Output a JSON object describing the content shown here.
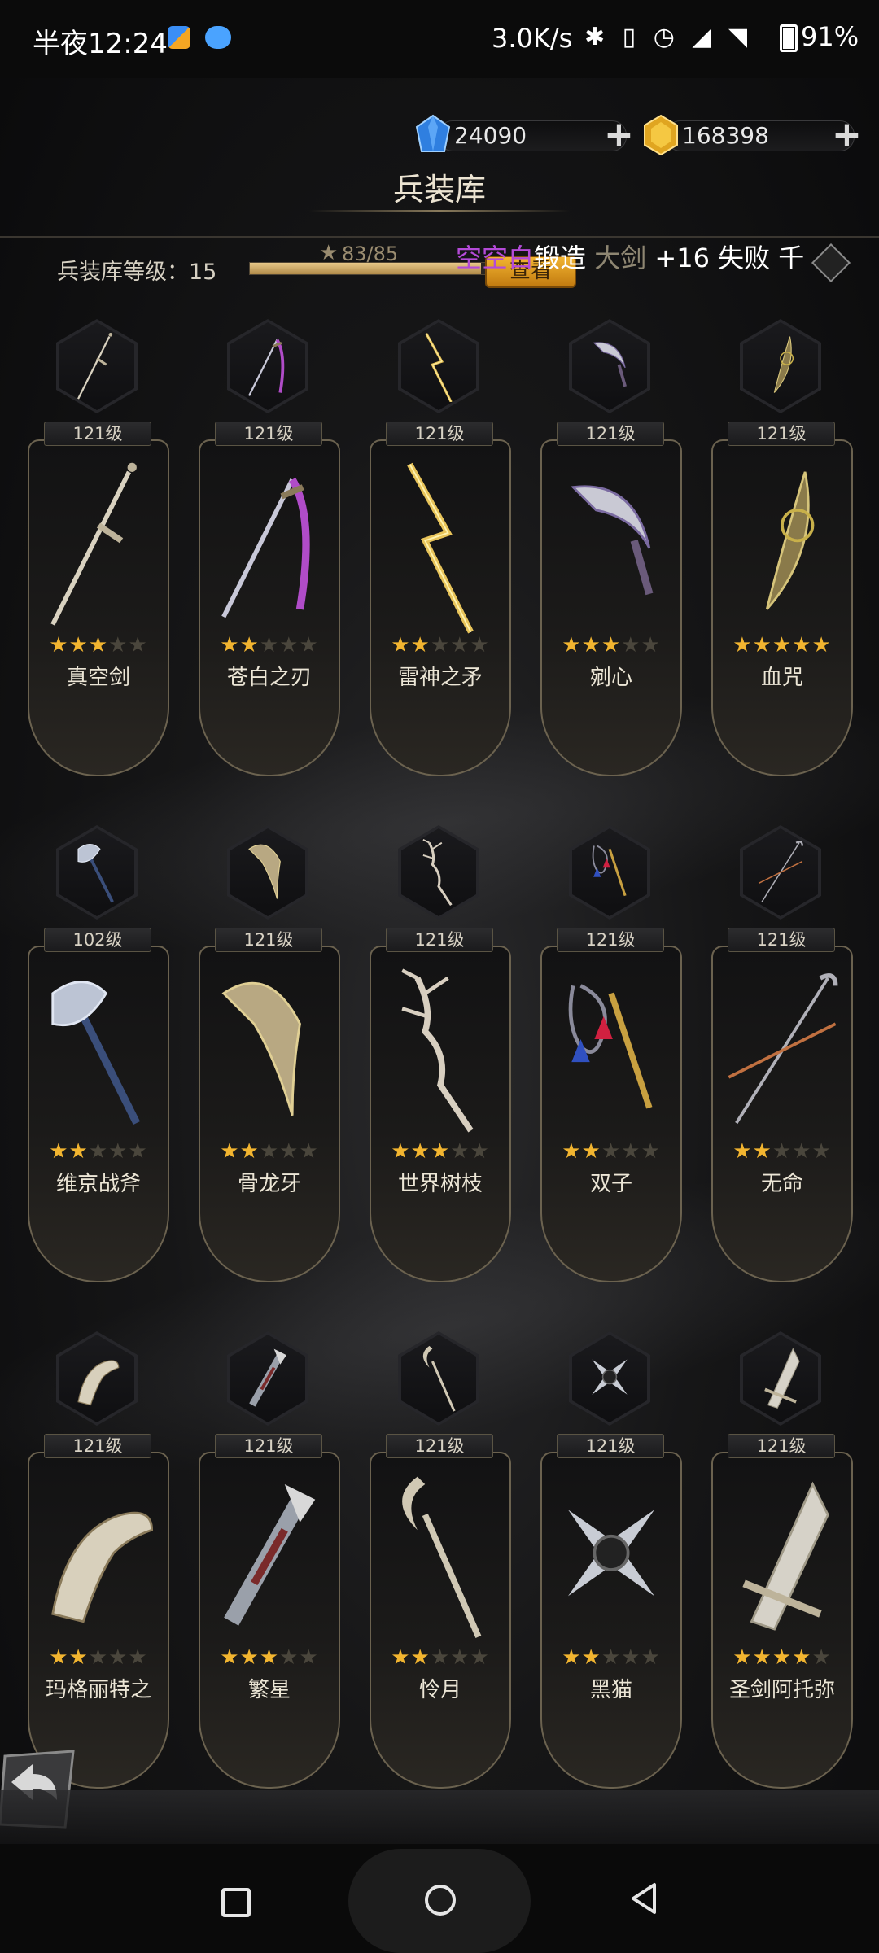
{
  "status_bar": {
    "time": "半夜12:24",
    "network_speed": "3.0K/s",
    "icons": "✱ ▯ ◷ ◢ ◥",
    "battery": "91%"
  },
  "header": {
    "title": "兵装库",
    "crystals": "24090",
    "gold": "168398",
    "add_label": "+"
  },
  "armory": {
    "level_label": "兵装库等级：15",
    "progress_text": "83/85",
    "progress_fraction": 0.98,
    "check_button": "查看",
    "ticker": {
      "player": "空空白",
      "action": "锻造",
      "item": "大剑",
      "result": "+16 失败",
      "more": "千"
    }
  },
  "weapons": [
    {
      "name": "真空剑",
      "level": "121级",
      "stars": 3,
      "icon": "sword-icon"
    },
    {
      "name": "苍白之刃",
      "level": "121级",
      "stars": 2,
      "icon": "katana-icon"
    },
    {
      "name": "雷神之矛",
      "level": "121级",
      "stars": 2,
      "icon": "spear-icon"
    },
    {
      "name": "剜心",
      "level": "121级",
      "stars": 3,
      "icon": "scimitar-icon"
    },
    {
      "name": "血咒",
      "level": "121级",
      "stars": 5,
      "icon": "dagger-icon"
    },
    {
      "name": "维京战斧",
      "level": "102级",
      "stars": 2,
      "icon": "axe-icon"
    },
    {
      "name": "骨龙牙",
      "level": "121级",
      "stars": 2,
      "icon": "hammer-icon"
    },
    {
      "name": "世界树枝",
      "level": "121级",
      "stars": 3,
      "icon": "staff-icon"
    },
    {
      "name": "双子",
      "level": "121级",
      "stars": 2,
      "icon": "flail-icon"
    },
    {
      "name": "无命",
      "level": "121级",
      "stars": 2,
      "icon": "cane-icon"
    },
    {
      "name": "玛格丽特之",
      "level": "121级",
      "stars": 2,
      "icon": "crossbow-icon"
    },
    {
      "name": "繁星",
      "level": "121级",
      "stars": 3,
      "icon": "gun-icon"
    },
    {
      "name": "怜月",
      "level": "121级",
      "stars": 2,
      "icon": "wand-icon"
    },
    {
      "name": "黑猫",
      "level": "121级",
      "stars": 2,
      "icon": "shuriken-icon"
    },
    {
      "name": "圣剑阿托弥",
      "level": "121级",
      "stars": 4,
      "icon": "greatsword-icon"
    }
  ],
  "colors": {
    "star_on": "#f2b530",
    "star_off": "#4a463c",
    "ticker_player": "#b44ad8"
  }
}
